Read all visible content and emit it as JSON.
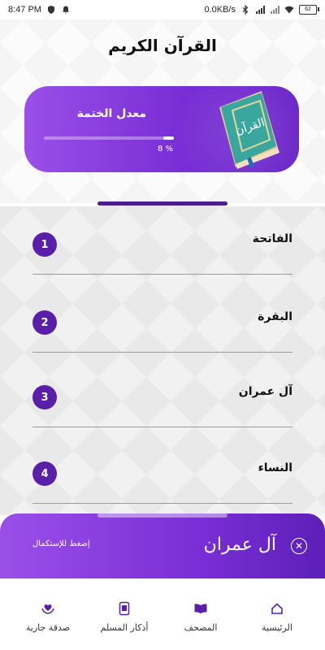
{
  "status_bar": {
    "time": "8:47 PM",
    "speed": "0.0KB/s",
    "battery": "62"
  },
  "header": {
    "title": "القرآن الكريم"
  },
  "progress_card": {
    "label": "معدل الختمة",
    "percent_text": "8 %",
    "progress": 0.08
  },
  "surahs": [
    {
      "number": "1",
      "name": "الفاتحة"
    },
    {
      "number": "2",
      "name": "البقرة"
    },
    {
      "number": "3",
      "name": "آل عمران"
    },
    {
      "number": "4",
      "name": "النساء"
    }
  ],
  "continue_reading": {
    "title": "آل عمران",
    "hint": "إضغط للإستكمال"
  },
  "bottom_nav": [
    {
      "label": "صدقة جارية",
      "icon": "heart-hands-icon"
    },
    {
      "label": "أذكار المسلم",
      "icon": "tablet-book-icon"
    },
    {
      "label": "المصحف",
      "icon": "open-book-icon"
    },
    {
      "label": "الرئيسية",
      "icon": "home-icon"
    }
  ],
  "colors": {
    "accent": "#7a2fd6",
    "accent_dark": "#5a1fa8",
    "handle": "#4a1d8f"
  }
}
